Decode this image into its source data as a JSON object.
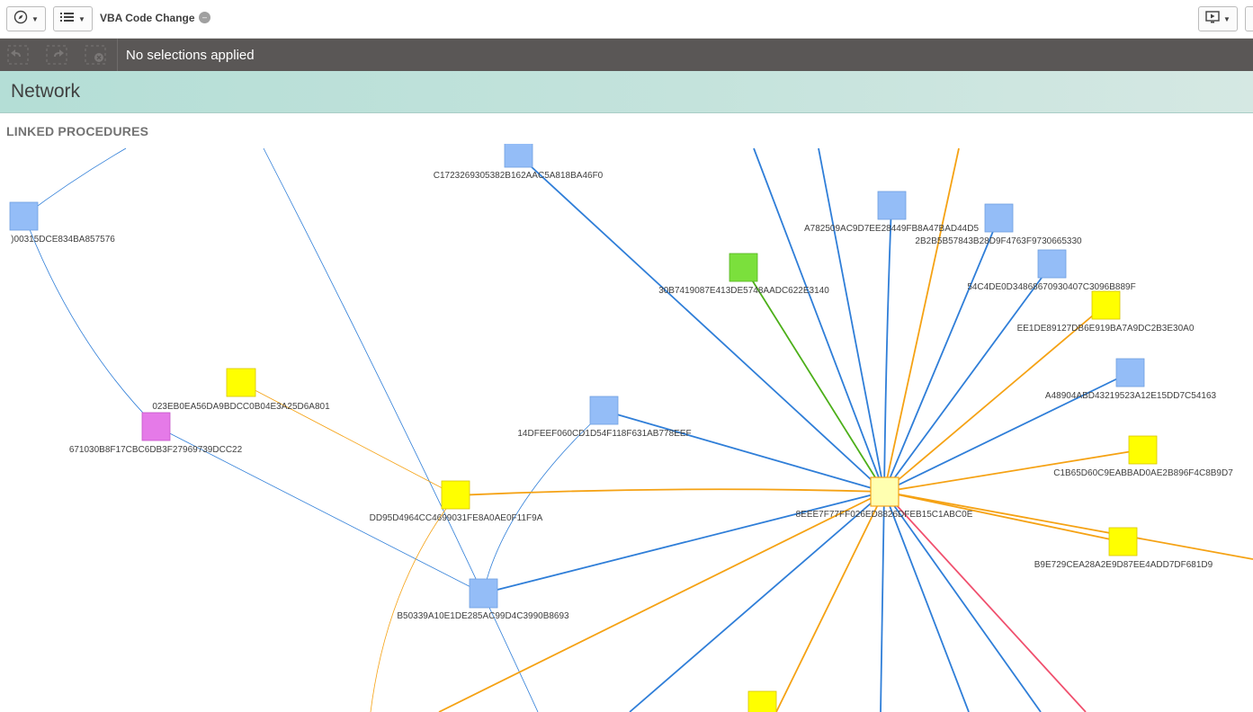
{
  "toolbar": {
    "app_title": "VBA Code Change",
    "nav_icon": "compass-icon",
    "sheets_icon": "list-icon",
    "presentation_icon": "screen-present-icon"
  },
  "selections": {
    "status": "No selections applied",
    "icons": [
      "step-back-icon",
      "step-forward-icon",
      "clear-selections-icon"
    ]
  },
  "sheet": {
    "title": "Network"
  },
  "viz": {
    "title": "LINKED PROCEDURES",
    "colors": {
      "blue": "#94bdf7",
      "yellow": "#ffff00",
      "green": "#7be03c",
      "magenta": "#e57ae8",
      "center": "#ffffb0",
      "edge_blue": "#2f7ed8",
      "edge_orange": "#f5a214",
      "edge_green": "#4caf19",
      "edge_red": "#f0506e"
    },
    "nodes": [
      {
        "id": "n1",
        "label": "C1723269305382B162AAC5A818BA46F0",
        "color": "blue"
      },
      {
        "id": "n2",
        "label": ")00315DCE834BA857576",
        "color": "blue"
      },
      {
        "id": "n3",
        "label": "A782509AC9D7EE28449FB8A47BAD44D5",
        "color": "blue"
      },
      {
        "id": "n4",
        "label": "2B2B5B57843B28D9F4763F9730665330",
        "color": "blue"
      },
      {
        "id": "n5",
        "label": "30B7419087E413DE5748AADC622E3140",
        "color": "green"
      },
      {
        "id": "n6",
        "label": "54C4DE0D34868670930407C3096B889F",
        "color": "blue"
      },
      {
        "id": "n7",
        "label": "EE1DE89127DB6E919BA7A9DC2B3E30A0",
        "color": "yellow"
      },
      {
        "id": "n8",
        "label": "A48904ABD43219523A12E15DD7C54163",
        "color": "blue"
      },
      {
        "id": "n9",
        "label": "023EB0EA56DA9BDCC0B04E3A25D6A801",
        "color": "yellow"
      },
      {
        "id": "n10",
        "label": "671030B8F17CBC6DB3F27969739DCC22",
        "color": "magenta"
      },
      {
        "id": "n11",
        "label": "14DFEEF060CD1D54F118F631AB778EEF",
        "color": "blue"
      },
      {
        "id": "n12",
        "label": "C1B65D60C9EABBAD0AE2B896F4C8B9D7",
        "color": "yellow"
      },
      {
        "id": "n13",
        "label": "DD95D4964CC4699031FE8A0AE0F11F9A",
        "color": "yellow"
      },
      {
        "id": "n14",
        "label": "8EEE7F77FF026ED8826DFEB15C1ABC0E",
        "color": "center"
      },
      {
        "id": "n15",
        "label": "B9E729CEA28A2E9D87EE4ADD7DF681D9",
        "color": "yellow"
      },
      {
        "id": "n16",
        "label": "B50339A10E1DE285AC99D4C3990B8693",
        "color": "blue"
      },
      {
        "id": "n17",
        "label": "",
        "color": "yellow"
      }
    ]
  }
}
